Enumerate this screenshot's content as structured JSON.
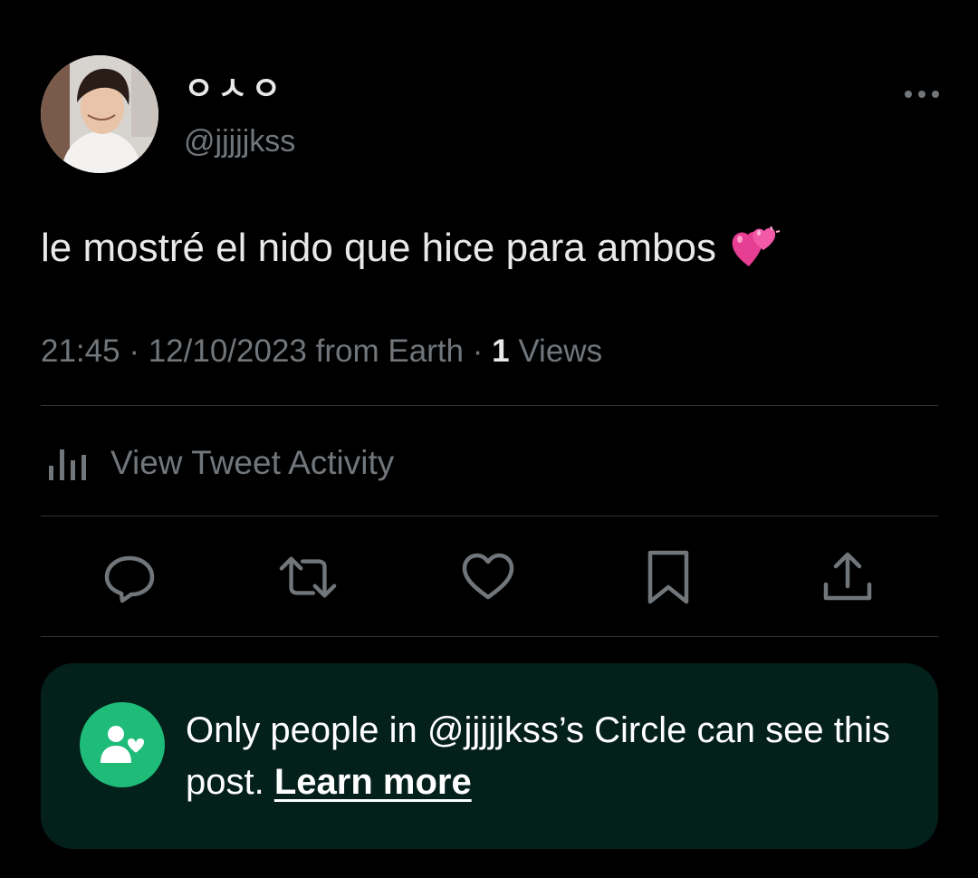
{
  "author": {
    "display_name": "ㅇㅅㅇ",
    "handle": "@jjjjjkss"
  },
  "tweet": {
    "text": "le mostré el nido que hice para ambos",
    "emoji": "two-hearts-emoji"
  },
  "meta": {
    "time": "21:45",
    "separator": "·",
    "date": "12/10/2023",
    "source": "from Earth",
    "views_count": "1",
    "views_label": "Views"
  },
  "activity": {
    "label": "View Tweet Activity"
  },
  "actions": {
    "icons": [
      "reply-icon",
      "retweet-icon",
      "like-icon",
      "bookmark-icon",
      "share-icon"
    ]
  },
  "circle_notice": {
    "text": "Only people in @jjjjjkss’s Circle can see this post.",
    "link": "Learn more"
  },
  "colors": {
    "background": "#000000",
    "primary_text": "#e7e9ea",
    "secondary_text": "#71767b",
    "divider": "#2f3336",
    "circle_banner_bg": "#03201a",
    "circle_green": "#1ebb79"
  }
}
